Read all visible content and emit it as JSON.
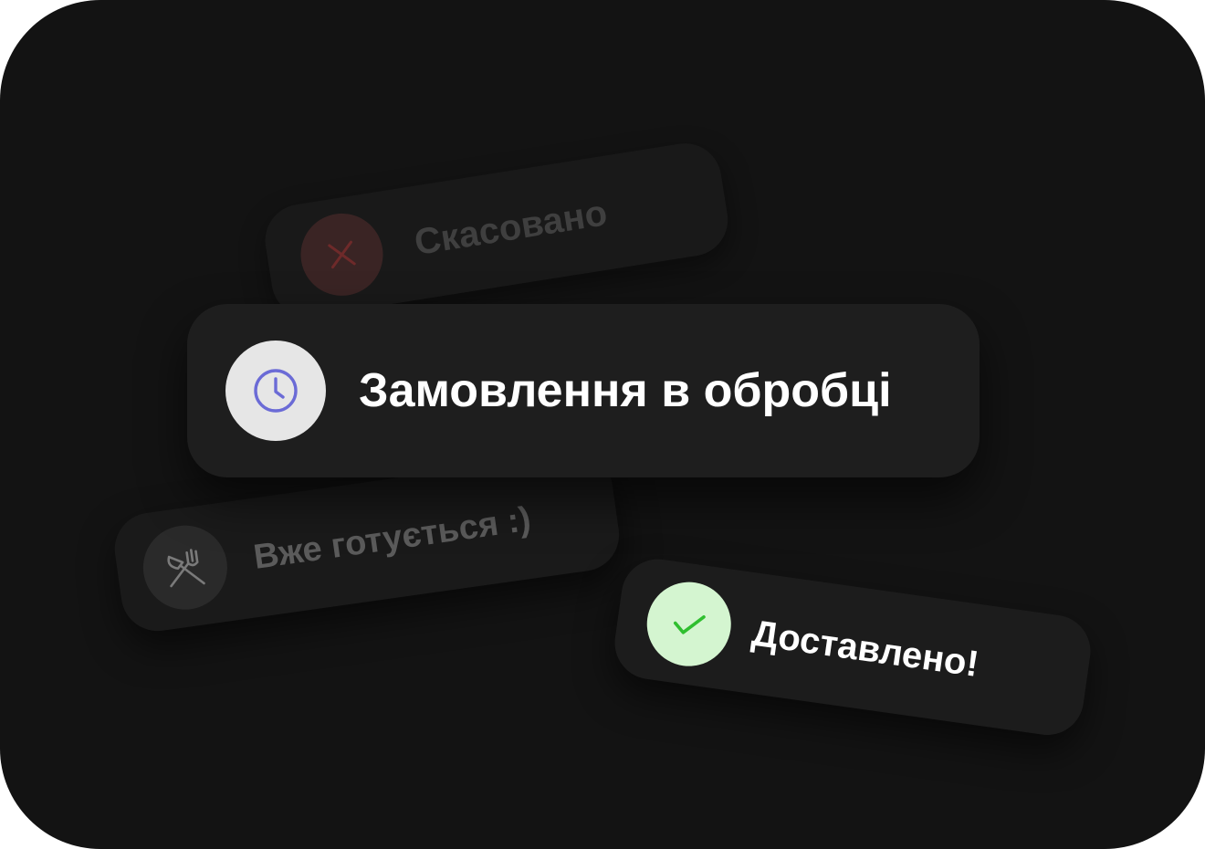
{
  "statuses": {
    "cancelled": {
      "label": "Скасовано",
      "icon": "close-icon",
      "color": "#7a2a2a"
    },
    "processing": {
      "label": "Замовлення в обробці",
      "icon": "clock-icon",
      "color": "#6b6bd6"
    },
    "preparing": {
      "label": "Вже готується :)",
      "icon": "fork-knife-icon",
      "color": "#5b5b5b"
    },
    "delivered": {
      "label": "Доставлено!",
      "icon": "check-icon",
      "color": "#2fbf2f"
    }
  },
  "colors": {
    "background": "#131313",
    "pill": "#1e1e1e"
  }
}
